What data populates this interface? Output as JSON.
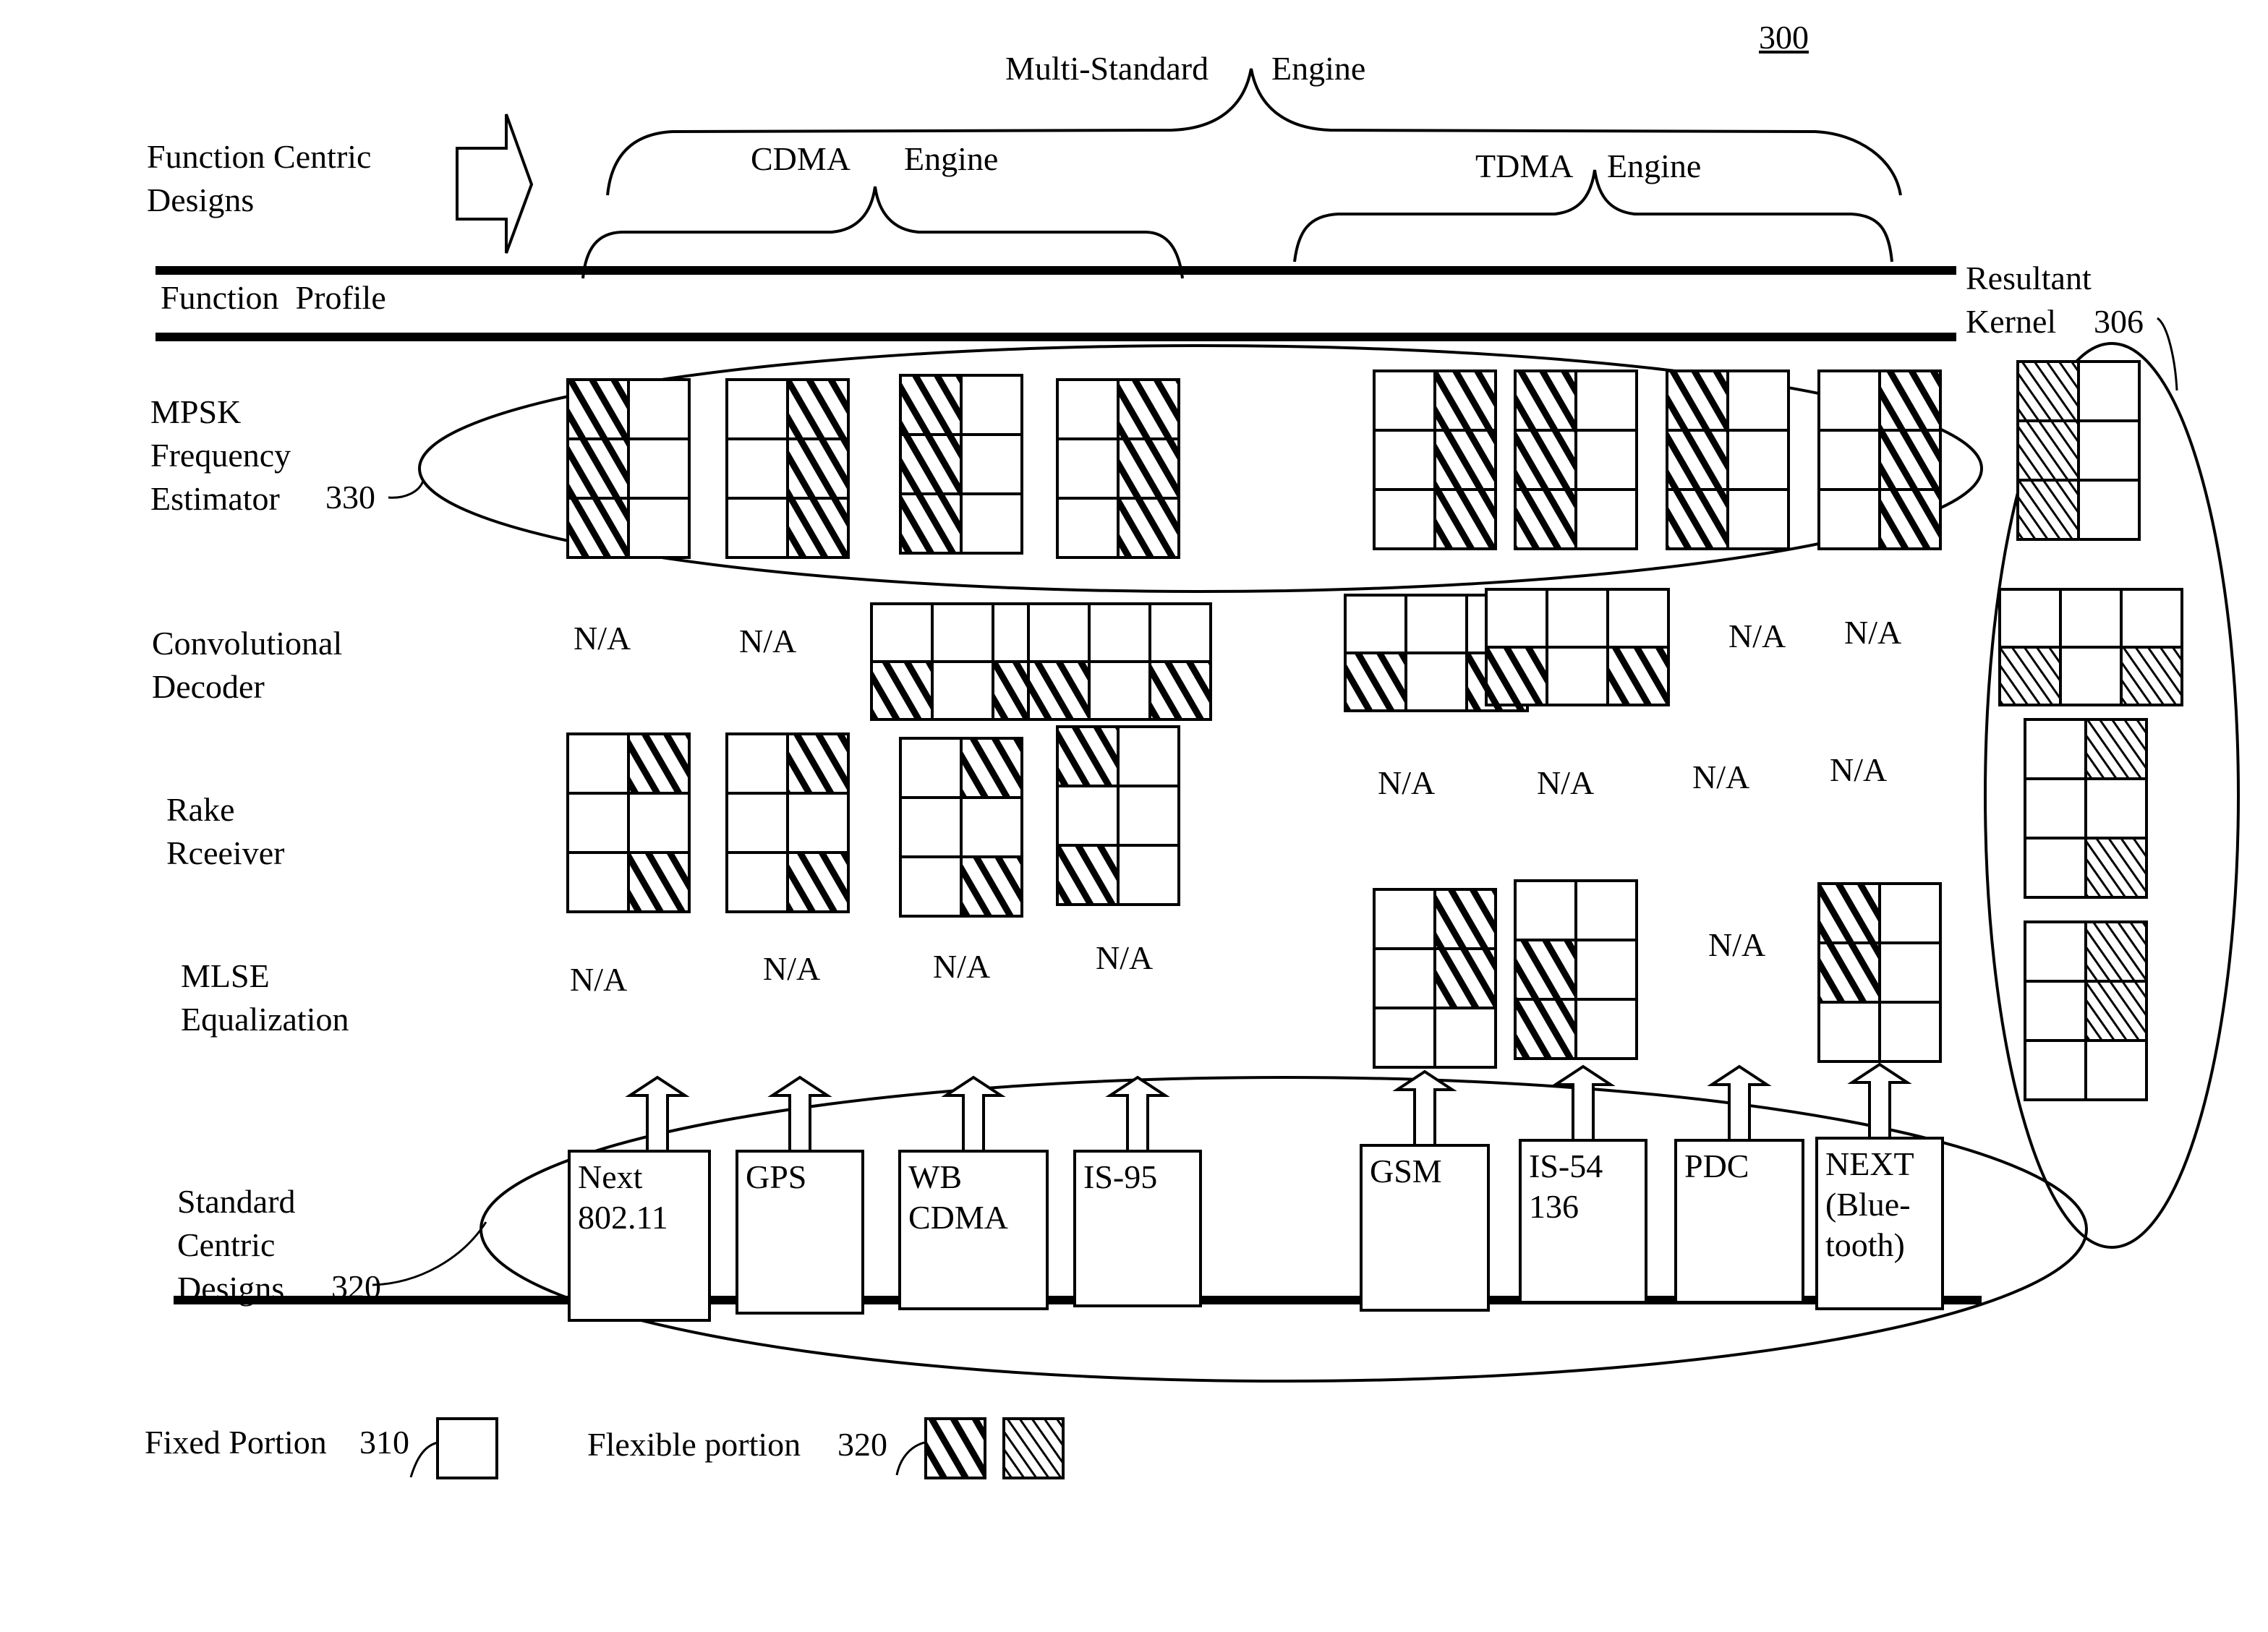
{
  "figure": {
    "number": "300",
    "top_labels": {
      "multi_standard": "Multi-Standard",
      "multi_engine": "Engine",
      "cdma": "CDMA",
      "cdma_engine": "Engine",
      "tdma": "TDMA",
      "tdma_engine": "Engine"
    },
    "left_labels": {
      "function_centric": "Function Centric\nDesigns",
      "function_profile": "Function  Profile",
      "mpsk": "MPSK\nFrequency\nEstimator",
      "mpsk_ref": "330",
      "conv": "Convolutional\nDecoder",
      "rake": "Rake\nRceeiver",
      "mlse": "MLSE\nEqualization",
      "standard_centric": "Standard\nCentric\nDesigns",
      "standard_centric_ref": "320"
    },
    "resultant_kernel": {
      "label": "Resultant\nKernel",
      "ref": "306"
    },
    "na_label": "N/A",
    "standards": [
      {
        "name": "Next\n802.11",
        "engine": "CDMA"
      },
      {
        "name": "GPS",
        "engine": "CDMA"
      },
      {
        "name": "WB\nCDMA",
        "engine": "CDMA"
      },
      {
        "name": "IS-95",
        "engine": "CDMA"
      },
      {
        "name": "GSM",
        "engine": "TDMA"
      },
      {
        "name": "IS-54\n136",
        "engine": "TDMA"
      },
      {
        "name": "PDC",
        "engine": "TDMA"
      },
      {
        "name": "NEXT\n(Blue-\ntooth)",
        "engine": "TDMA"
      }
    ],
    "function_grids": {
      "mpsk": [
        {
          "shaded": [
            [
              1,
              0
            ],
            [
              1,
              0
            ],
            [
              1,
              0
            ]
          ]
        },
        {
          "shaded": [
            [
              0,
              1
            ],
            [
              0,
              1
            ],
            [
              0,
              1
            ]
          ]
        },
        {
          "shaded": [
            [
              1,
              0
            ],
            [
              1,
              0
            ],
            [
              1,
              0
            ]
          ]
        },
        {
          "shaded": [
            [
              0,
              1
            ],
            [
              0,
              1
            ],
            [
              0,
              1
            ]
          ]
        },
        {
          "shaded": [
            [
              0,
              1
            ],
            [
              0,
              1
            ],
            [
              0,
              1
            ]
          ]
        },
        {
          "shaded": [
            [
              1,
              0
            ],
            [
              1,
              0
            ],
            [
              1,
              0
            ]
          ]
        },
        {
          "shaded": [
            [
              1,
              0
            ],
            [
              1,
              0
            ],
            [
              1,
              0
            ]
          ]
        },
        {
          "shaded": [
            [
              0,
              1
            ],
            [
              0,
              1
            ],
            [
              0,
              1
            ]
          ]
        }
      ],
      "conv": [
        null,
        null,
        {
          "shaded": [
            [
              0,
              0,
              0
            ],
            [
              1,
              0,
              1
            ]
          ]
        },
        {
          "shaded": [
            [
              0,
              0,
              0
            ],
            [
              1,
              0,
              1
            ]
          ]
        },
        {
          "shaded": [
            [
              0,
              0,
              0
            ],
            [
              1,
              0,
              1
            ]
          ]
        },
        {
          "shaded": [
            [
              0,
              0,
              0
            ],
            [
              1,
              0,
              1
            ]
          ]
        },
        null,
        null
      ],
      "rake": [
        {
          "shaded": [
            [
              0,
              1
            ],
            [
              0,
              0
            ],
            [
              0,
              1
            ]
          ]
        },
        {
          "shaded": [
            [
              0,
              1
            ],
            [
              0,
              0
            ],
            [
              0,
              1
            ]
          ]
        },
        {
          "shaded": [
            [
              0,
              1
            ],
            [
              0,
              0
            ],
            [
              0,
              1
            ]
          ]
        },
        {
          "shaded": [
            [
              1,
              0
            ],
            [
              0,
              0
            ],
            [
              1,
              0
            ]
          ]
        },
        null,
        null,
        null,
        null
      ],
      "mlse": [
        null,
        null,
        null,
        null,
        {
          "shaded": [
            [
              0,
              1
            ],
            [
              0,
              1
            ],
            [
              0,
              0
            ]
          ]
        },
        {
          "shaded": [
            [
              0,
              0
            ],
            [
              1,
              0
            ],
            [
              1,
              0
            ]
          ]
        },
        null,
        {
          "shaded": [
            [
              1,
              0
            ],
            [
              1,
              0
            ],
            [
              0,
              0
            ]
          ]
        }
      ]
    },
    "kernel_grids": [
      {
        "function": "mpsk",
        "shaded": [
          [
            1,
            0
          ],
          [
            1,
            0
          ],
          [
            1,
            0
          ]
        ]
      },
      {
        "function": "conv",
        "shaded": [
          [
            0,
            0,
            0
          ],
          [
            1,
            0,
            1
          ]
        ]
      },
      {
        "function": "rake",
        "shaded": [
          [
            0,
            1
          ],
          [
            0,
            0
          ],
          [
            0,
            1
          ]
        ]
      },
      {
        "function": "mlse",
        "shaded": [
          [
            0,
            1
          ],
          [
            0,
            1
          ],
          [
            0,
            0
          ]
        ]
      }
    ],
    "legend": {
      "fixed_label": "Fixed Portion",
      "fixed_ref": "310",
      "flexible_label": "Flexible portion",
      "flexible_ref": "320"
    }
  }
}
